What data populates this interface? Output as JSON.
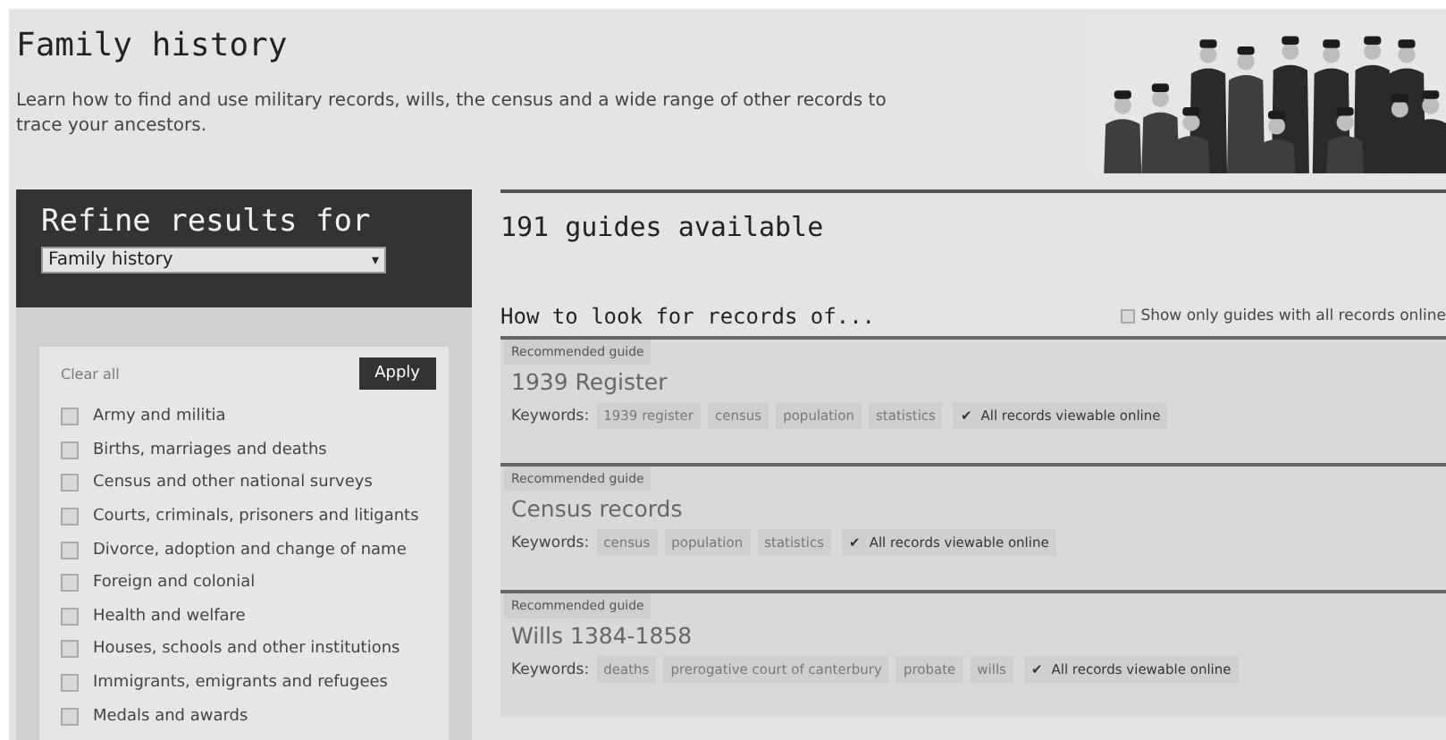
{
  "header": {
    "title": "Family history",
    "description": "Learn how to find and use military records, wills, the census and a wide range of other records to trace your ancestors."
  },
  "sidebar": {
    "title": "Refine results for",
    "dropdown": {
      "value": "Family history",
      "arrow": "▾"
    },
    "clear_all": "Clear all",
    "apply": "Apply",
    "filters": [
      {
        "label": "Army and militia",
        "checked": false
      },
      {
        "label": "Births, marriages and deaths",
        "checked": false
      },
      {
        "label": "Census and other national surveys",
        "checked": false
      },
      {
        "label": "Courts, criminals, prisoners and litigants",
        "checked": false
      },
      {
        "label": "Divorce, adoption and change of name",
        "checked": false
      },
      {
        "label": "Foreign and colonial",
        "checked": false
      },
      {
        "label": "Health and welfare",
        "checked": false
      },
      {
        "label": "Houses, schools and other institutions",
        "checked": false
      },
      {
        "label": "Immigrants, emigrants and refugees",
        "checked": false
      },
      {
        "label": "Medals and awards",
        "checked": false
      }
    ]
  },
  "results": {
    "count": "191 guides available",
    "subheading": "How to look for records of...",
    "online_only": {
      "label": "Show only guides with all records online",
      "checked": false
    },
    "guides": [
      {
        "badge": "Recommended guide",
        "title": "1939 Register",
        "keywords_label": "Keywords:",
        "keywords": [
          "1939 register",
          "census",
          "population",
          "statistics"
        ],
        "online": {
          "mark": "✔",
          "label": "All records viewable online"
        }
      },
      {
        "badge": "Recommended guide",
        "title": "Census records",
        "keywords_label": "Keywords:",
        "keywords": [
          "census",
          "population",
          "statistics"
        ],
        "online": {
          "mark": "✔",
          "label": "All records viewable online"
        }
      },
      {
        "badge": "Recommended guide",
        "title": "Wills 1384-1858",
        "keywords_label": "Keywords:",
        "keywords": [
          "deaths",
          "prerogative court of canterbury",
          "probate",
          "wills"
        ],
        "online": {
          "mark": "✔",
          "label": "All records viewable online"
        }
      }
    ]
  }
}
